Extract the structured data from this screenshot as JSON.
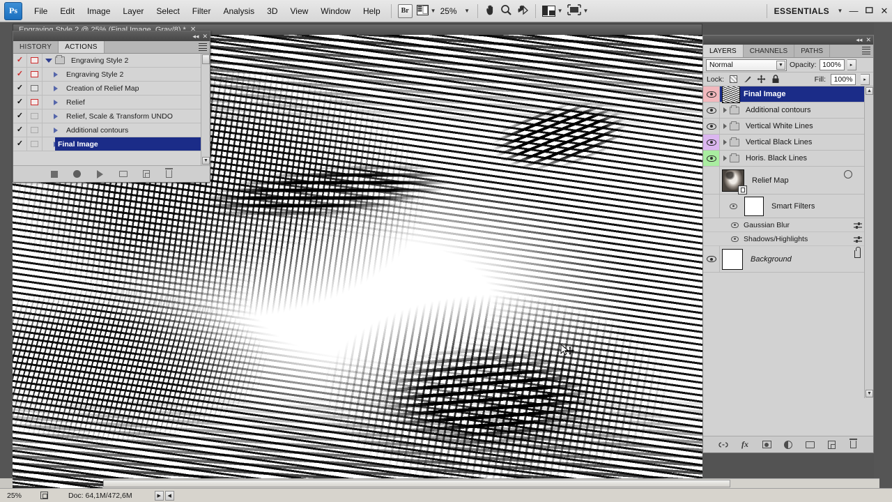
{
  "app": {
    "name": "Adobe Photoshop",
    "logo_text": "Ps",
    "workspace": "ESSENTIALS",
    "zoom_level": "25%"
  },
  "menubar": {
    "items": [
      "File",
      "Edit",
      "Image",
      "Layer",
      "Select",
      "Filter",
      "Analysis",
      "3D",
      "View",
      "Window",
      "Help"
    ],
    "bridge_label": "Br",
    "window_controls": {
      "minimize": "—",
      "maximize": "❐",
      "close": "✕"
    }
  },
  "document": {
    "tab_title": "Engraving Style 2 @ 25% (Final Image, Gray/8) *",
    "close_glyph": "✕"
  },
  "actions_panel": {
    "tabs": [
      {
        "label": "HISTORY",
        "active": false
      },
      {
        "label": "ACTIONS",
        "active": true
      }
    ],
    "rows": [
      {
        "label": "Engraving Style 2",
        "checked": true,
        "check_color": "red",
        "dialog": "red",
        "type": "set",
        "expanded": true,
        "selected": false
      },
      {
        "label": "Engraving Style 2",
        "checked": true,
        "check_color": "red",
        "dialog": "red",
        "type": "action",
        "expanded": false,
        "selected": false
      },
      {
        "label": "Creation of Relief Map",
        "checked": true,
        "check_color": "black",
        "dialog": "gray",
        "type": "action",
        "expanded": false,
        "selected": false
      },
      {
        "label": "Relief",
        "checked": true,
        "check_color": "black",
        "dialog": "red",
        "type": "action",
        "expanded": false,
        "selected": false
      },
      {
        "label": "Relief, Scale & Transform UNDO",
        "checked": true,
        "check_color": "black",
        "dialog": "empty",
        "type": "action",
        "expanded": false,
        "selected": false
      },
      {
        "label": "Additional contours",
        "checked": true,
        "check_color": "black",
        "dialog": "empty",
        "type": "action",
        "expanded": false,
        "selected": false
      },
      {
        "label": "Final Image",
        "checked": true,
        "check_color": "black",
        "dialog": "empty",
        "type": "action",
        "expanded": false,
        "selected": true
      }
    ],
    "footer_buttons": [
      "stop-button",
      "record-button",
      "play-button",
      "new-set-button",
      "new-action-button",
      "delete-button"
    ]
  },
  "layers_panel": {
    "tabs": [
      {
        "label": "LAYERS",
        "active": true
      },
      {
        "label": "CHANNELS",
        "active": false
      },
      {
        "label": "PATHS",
        "active": false
      }
    ],
    "blend_mode": "Normal",
    "opacity_label": "Opacity:",
    "opacity_value": "100%",
    "lock_label": "Lock:",
    "fill_label": "Fill:",
    "fill_value": "100%",
    "layers": [
      {
        "name": "Final Image",
        "type": "layer",
        "visible": true,
        "selected": true,
        "group_color": "pink",
        "thumb": "engrave"
      },
      {
        "name": "Additional contours",
        "type": "group",
        "visible": true,
        "selected": false,
        "group_color": "none",
        "thumb": "folder"
      },
      {
        "name": "Vertical White Lines",
        "type": "group",
        "visible": true,
        "selected": false,
        "group_color": "none",
        "thumb": "folder"
      },
      {
        "name": "Vertical Black Lines",
        "type": "group",
        "visible": true,
        "selected": false,
        "group_color": "purple",
        "thumb": "folder"
      },
      {
        "name": "Horis. Black Lines",
        "type": "group",
        "visible": true,
        "selected": false,
        "group_color": "green",
        "thumb": "folder"
      },
      {
        "name": "Relief Map",
        "type": "smart",
        "visible": false,
        "selected": false,
        "group_color": "none",
        "thumb": "face"
      }
    ],
    "smart_filters": {
      "label": "Smart Filters",
      "filters": [
        "Gaussian Blur",
        "Shadows/Highlights"
      ]
    },
    "background_layer": {
      "name": "Background",
      "visible": true,
      "locked": true
    },
    "footer_buttons": [
      "link-layers",
      "layer-style-fx",
      "layer-mask",
      "adjustment-layer",
      "new-group",
      "new-layer",
      "delete-layer"
    ]
  },
  "statusbar": {
    "zoom": "25%",
    "doc_info": "Doc: 64,1M/472,6M"
  },
  "colors": {
    "selection_blue": "#1b2c88",
    "panel_gray": "#d2d2d2",
    "group_pink": "#f2b8bd",
    "group_purple": "#dbb6f0",
    "group_green": "#a9eda0",
    "accent_red": "#cc2b2b"
  }
}
